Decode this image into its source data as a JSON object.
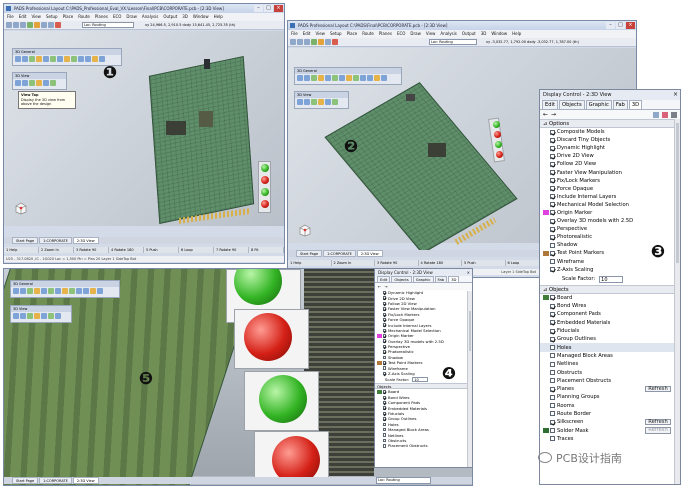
{
  "window1": {
    "title": "PADS Professional Layout  C:\\PADS_Professional_Eval_VX.\\Lesson\\Final\\PCB\\CORPORATE.pcb - [2:3D View]",
    "menus": [
      "File",
      "Edit",
      "View",
      "Setup",
      "Place",
      "Route",
      "Planes",
      "ECO",
      "Draw",
      "Analysis",
      "Output",
      "3D",
      "Window",
      "Help"
    ],
    "coords": "xy 24,966.5, 2,910.5  dxdy 15,641.45, 2,725.35 (th)",
    "combo": "Loc: Routing",
    "float1_title": "3D General",
    "float2_title": "3D View",
    "tooltip_title": "View Top",
    "tooltip_text": "Display the 3D view from above the design",
    "fkeys": [
      "1 Help",
      "2 Zoom In",
      "3 Rotate 90",
      "4 Rotate 180",
      "5 Push",
      "6 Loop",
      "7 Rotate 90",
      "8 Fit"
    ],
    "tabs": [
      "Start Page",
      "1:CORPORATE",
      "2:3D View"
    ],
    "status": "U25 - 317.0820 ,IC - 1G020      Loc = 1,500 Pin = Pins 20      Layer 1 SideTop Bot"
  },
  "window2": {
    "title": "PADS Professional Layout  C:\\PADS\\Final\\PCB\\CORPORATE.pcb - [2:3D View]",
    "menus": [
      "File",
      "Edit",
      "View",
      "Setup",
      "Place",
      "Route",
      "Planes",
      "ECO",
      "Draw",
      "View",
      "Analysis",
      "Output",
      "3D",
      "Window",
      "Help"
    ],
    "coords": "xy -3,032.77, 1,792.00  dxdy -3,032.77, 1,787.00 (th)",
    "combo": "Loc: Routing",
    "float1_title": "3D General",
    "float2_title": "3D View",
    "fkeys": [
      "1 Help",
      "2 Zoom In",
      "3 Rotate 90",
      "4 Rotate 180",
      "5 Push",
      "6 Loop",
      "7 Rotate 90",
      "8 Fit"
    ],
    "tabs": [
      "Start Page",
      "1:CORPORATE",
      "2:3D View"
    ],
    "status": "Layer 1 SideTop Bot"
  },
  "window3": {
    "float1_title": "3D General",
    "float2_title": "3D View",
    "tabs": [
      "Start Page",
      "1:CORPORATE",
      "2:3D View"
    ],
    "combo": "Loc: Routing"
  },
  "panel_large": {
    "title": "Display Control - 2:3D View",
    "tabs": [
      "Edit",
      "Objects",
      "Graphic",
      "Fab",
      "3D"
    ],
    "options_header": "Options",
    "options": [
      {
        "label": "Composite Models",
        "checked": true
      },
      {
        "label": "Discard Tiny Objects",
        "checked": true
      },
      {
        "label": "Dynamic Highlight",
        "checked": true
      },
      {
        "label": "Drive 2D View",
        "checked": true
      },
      {
        "label": "Follow 2D View",
        "checked": true
      },
      {
        "label": "Faster View Manipulation",
        "checked": true
      },
      {
        "label": "Fix/Lock Markers",
        "checked": true
      },
      {
        "label": "Force Opaque",
        "checked": true
      },
      {
        "label": "Include Internal Layers",
        "checked": true
      },
      {
        "label": "Mechanical Model Selection",
        "checked": true
      },
      {
        "label": "Origin Marker",
        "checked": true,
        "swatch": "#e040e0"
      },
      {
        "label": "Overlay 3D models with 2.5D",
        "checked": true
      },
      {
        "label": "Perspective",
        "checked": true
      },
      {
        "label": "Photorealistic",
        "checked": true
      },
      {
        "label": "Shadow",
        "checked": false
      },
      {
        "label": "Test Point Markers",
        "checked": true,
        "swatch": "#b0773a"
      },
      {
        "label": "Wireframe",
        "checked": false
      },
      {
        "label": "Z-Axis Scaling",
        "checked": true
      }
    ],
    "scale_label": "Scale Factor:",
    "scale_value": "10",
    "objects_header": "Objects",
    "objects": [
      {
        "label": "Board",
        "checked": true,
        "swatch": "#3f7f3a"
      },
      {
        "label": "Bond Wires",
        "checked": true
      },
      {
        "label": "Component Pads",
        "checked": true
      },
      {
        "label": "Embedded Materials",
        "checked": true
      },
      {
        "label": "Fiducials",
        "checked": true
      },
      {
        "label": "Group Outlines",
        "checked": true
      },
      {
        "label": "Holes",
        "checked": false,
        "highlight": true
      },
      {
        "label": "Managed Block Areas",
        "checked": false
      },
      {
        "label": "Netlines",
        "checked": false
      },
      {
        "label": "Obstructs",
        "checked": false
      },
      {
        "label": "Placement Obstructs",
        "checked": false
      },
      {
        "label": "Planes",
        "checked": true,
        "button": "Refresh"
      },
      {
        "label": "Planning Groups",
        "checked": false
      },
      {
        "label": "Rooms",
        "checked": false
      },
      {
        "label": "Route Border",
        "checked": false
      },
      {
        "label": "Silkscreen",
        "checked": true,
        "button": "Refresh"
      },
      {
        "label": "Solder Mask",
        "checked": false,
        "swatch": "#2f6e33",
        "button": "Refresh",
        "button_disabled": true
      },
      {
        "label": "Traces",
        "checked": false
      }
    ]
  },
  "panel_small": {
    "title": "Display Control - 2:3D View",
    "tabs": [
      "Edit",
      "Objects",
      "Graphic",
      "Fab",
      "3D"
    ],
    "options": [
      {
        "label": "Dynamic Highlight",
        "checked": true
      },
      {
        "label": "Drive 2D View",
        "checked": true
      },
      {
        "label": "Follow 2D View",
        "checked": true
      },
      {
        "label": "Faster View Manipulation",
        "checked": true
      },
      {
        "label": "Fix/Lock Markers",
        "checked": true
      },
      {
        "label": "Force Opaque",
        "checked": true
      },
      {
        "label": "Include Internal Layers",
        "checked": true
      },
      {
        "label": "Mechanical Model Selection",
        "checked": true
      },
      {
        "label": "Origin Marker",
        "checked": true,
        "swatch": "#e040e0"
      },
      {
        "label": "Overlay 3D models with 2.5D",
        "checked": true
      },
      {
        "label": "Perspective",
        "checked": true
      },
      {
        "label": "Photorealistic",
        "checked": true
      },
      {
        "label": "Shadow",
        "checked": false
      },
      {
        "label": "Test Point Markers",
        "checked": true,
        "swatch": "#b0773a"
      },
      {
        "label": "Wireframe",
        "checked": false
      },
      {
        "label": "Z-Axis Scaling",
        "checked": true
      }
    ],
    "scale_label": "Scale Factor:",
    "scale_value": "10",
    "objects_header": "Objects",
    "objects": [
      {
        "label": "Board",
        "checked": true,
        "swatch": "#3f7f3a"
      },
      {
        "label": "Bond Wires",
        "checked": true
      },
      {
        "label": "Component Pads",
        "checked": true
      },
      {
        "label": "Embedded Materials",
        "checked": true
      },
      {
        "label": "Fiducials",
        "checked": true
      },
      {
        "label": "Group Outlines",
        "checked": true
      },
      {
        "label": "Holes",
        "checked": false
      },
      {
        "label": "Managed Block Areas",
        "checked": false
      },
      {
        "label": "Netlines",
        "checked": false
      },
      {
        "label": "Obstructs",
        "checked": false
      },
      {
        "label": "Placement Obstructs",
        "checked": false
      }
    ]
  },
  "badges": [
    "❶",
    "❷",
    "❸",
    "❹",
    "❺"
  ],
  "watermark": "PCB设计指南"
}
